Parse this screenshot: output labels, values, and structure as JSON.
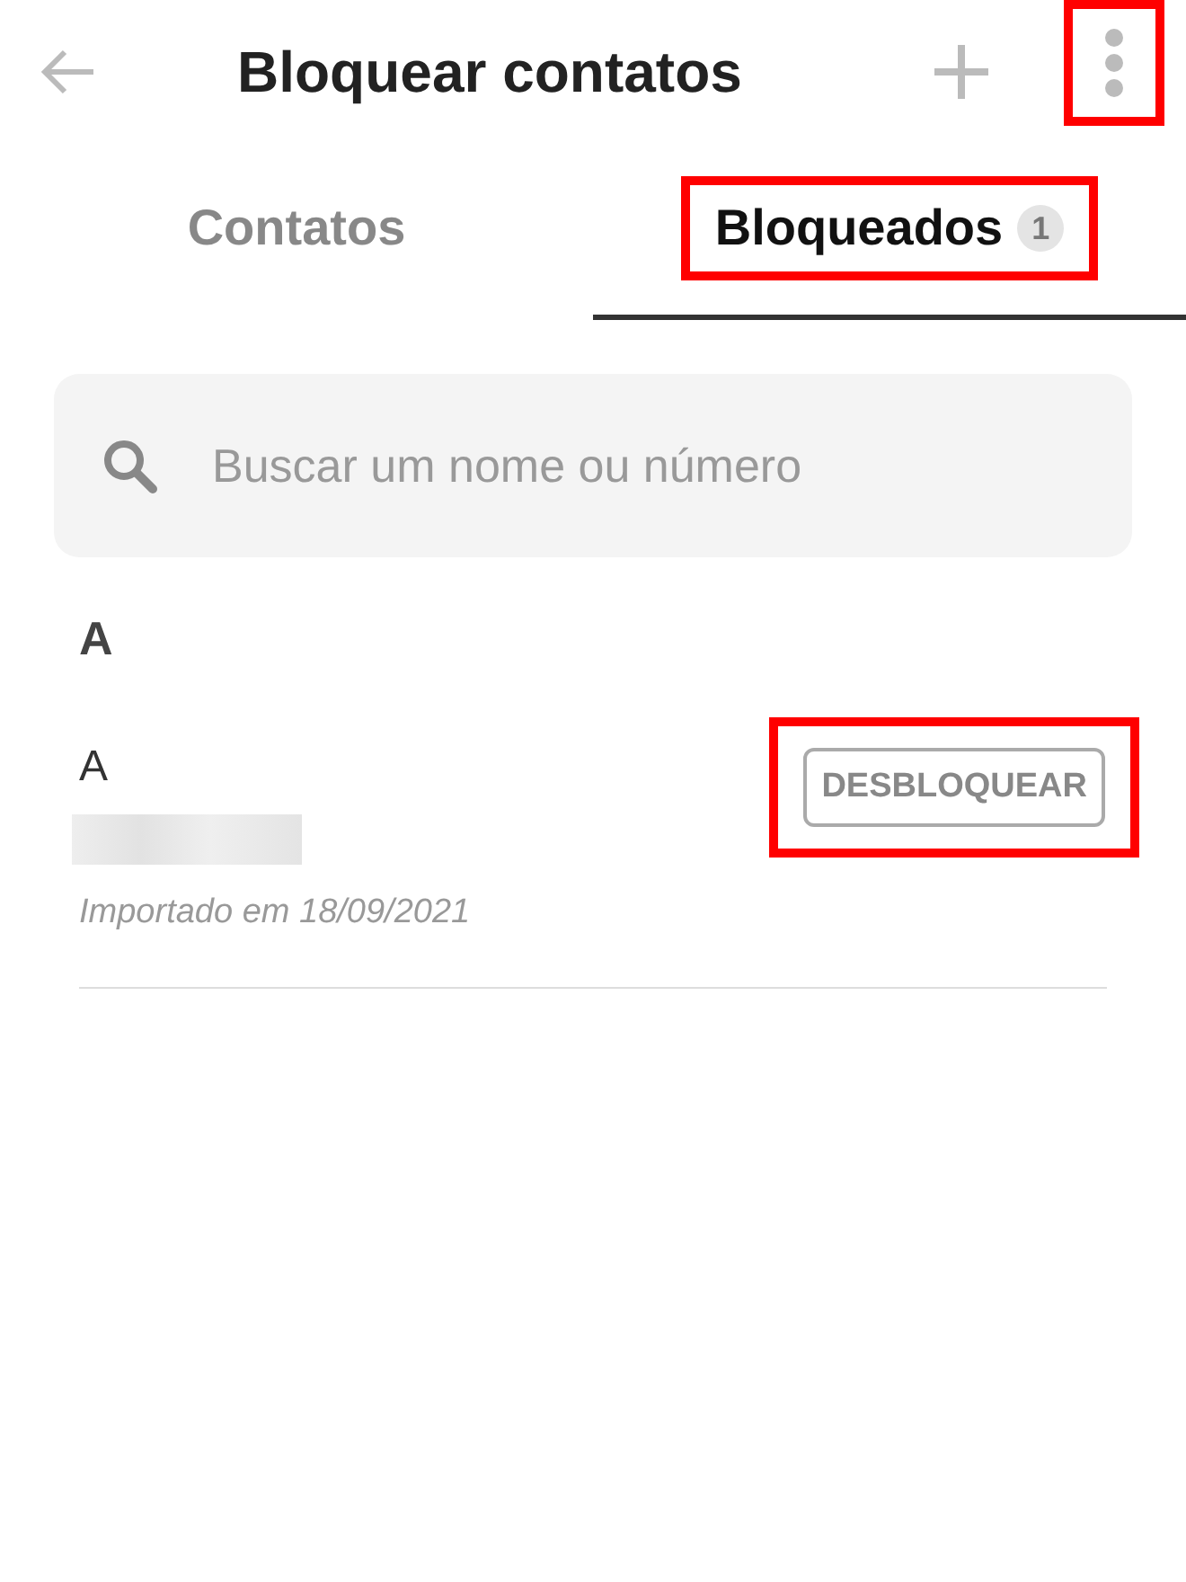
{
  "header": {
    "title": "Bloquear contatos",
    "menu_highlighted": true
  },
  "tabs": [
    {
      "label": "Contatos",
      "selected": false,
      "highlighted": false
    },
    {
      "label": "Bloqueados",
      "badge": "1",
      "selected": true,
      "highlighted": true
    }
  ],
  "search": {
    "placeholder": "Buscar um nome ou número"
  },
  "sections": [
    {
      "letter": "A",
      "contacts": [
        {
          "name": "A",
          "note": "Importado em 18/09/2021",
          "action": "DESBLOQUEAR",
          "action_highlighted": true
        }
      ]
    }
  ]
}
